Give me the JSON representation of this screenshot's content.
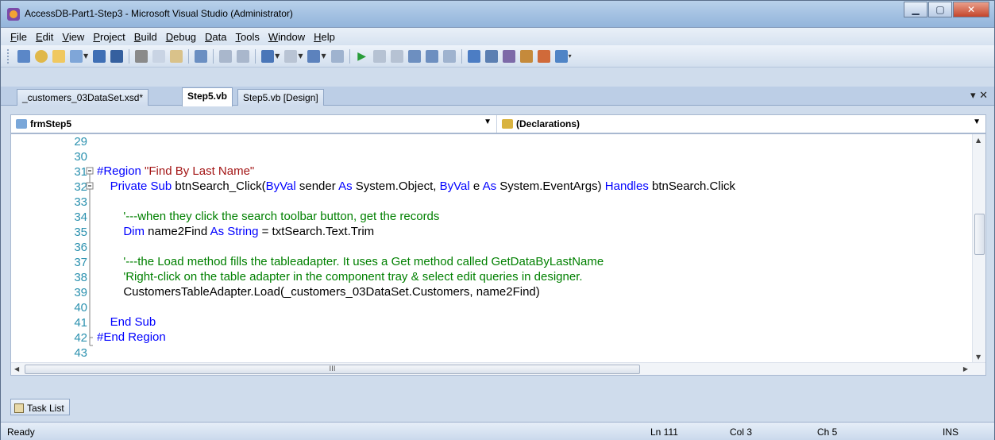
{
  "window": {
    "title": "AccessDB-Part1-Step3 - Microsoft Visual Studio (Administrator)"
  },
  "menu": [
    "File",
    "Edit",
    "View",
    "Project",
    "Build",
    "Debug",
    "Data",
    "Tools",
    "Window",
    "Help"
  ],
  "tabs": [
    {
      "label": "_customers_03DataSet.xsd*",
      "active": false
    },
    {
      "label": "Step5.vb",
      "active": true
    },
    {
      "label": "Step5.vb [Design]",
      "active": false
    }
  ],
  "tab_controls": "▾ ✕",
  "navbar": {
    "class_selector": "frmStep5",
    "member_selector": "(Declarations)"
  },
  "editor": {
    "line_numbers": [
      "29",
      "30",
      "31",
      "32",
      "33",
      "34",
      "35",
      "36",
      "37",
      "38",
      "39",
      "40",
      "41",
      "42",
      "43"
    ],
    "lines": [
      "",
      "",
      "#Region \"Find By Last Name\"",
      "    Private Sub btnSearch_Click(ByVal sender As System.Object, ByVal e As System.EventArgs) Handles btnSearch.Click",
      "",
      "        '---when they click the search toolbar button, get the records",
      "        Dim name2Find As String = txtSearch.Text.Trim",
      "",
      "        '---the Load method fills the tableadapter. It uses a Get method called GetDataByLastName",
      "        'Right-click on the table adapter in the component tray & select edit queries in designer.",
      "        CustomersTableAdapter.Load(_customers_03DataSet.Customers, name2Find)",
      "",
      "    End Sub",
      "#End Region",
      ""
    ],
    "hscroll_thumb": "III"
  },
  "bottom_panel": {
    "tab": "Task List"
  },
  "status": {
    "text": "Ready",
    "line": "Ln 111",
    "col": "Col 3",
    "ch": "Ch 5",
    "mode": "INS"
  },
  "colors": {
    "keyword": "#0000ff",
    "comment": "#008000",
    "string": "#a31515",
    "line_number": "#2b91af"
  },
  "icons": [
    "app-icon",
    "minimize-icon",
    "maximize-icon",
    "close-icon",
    "class-icon",
    "declarations-icon",
    "task-list-icon"
  ]
}
